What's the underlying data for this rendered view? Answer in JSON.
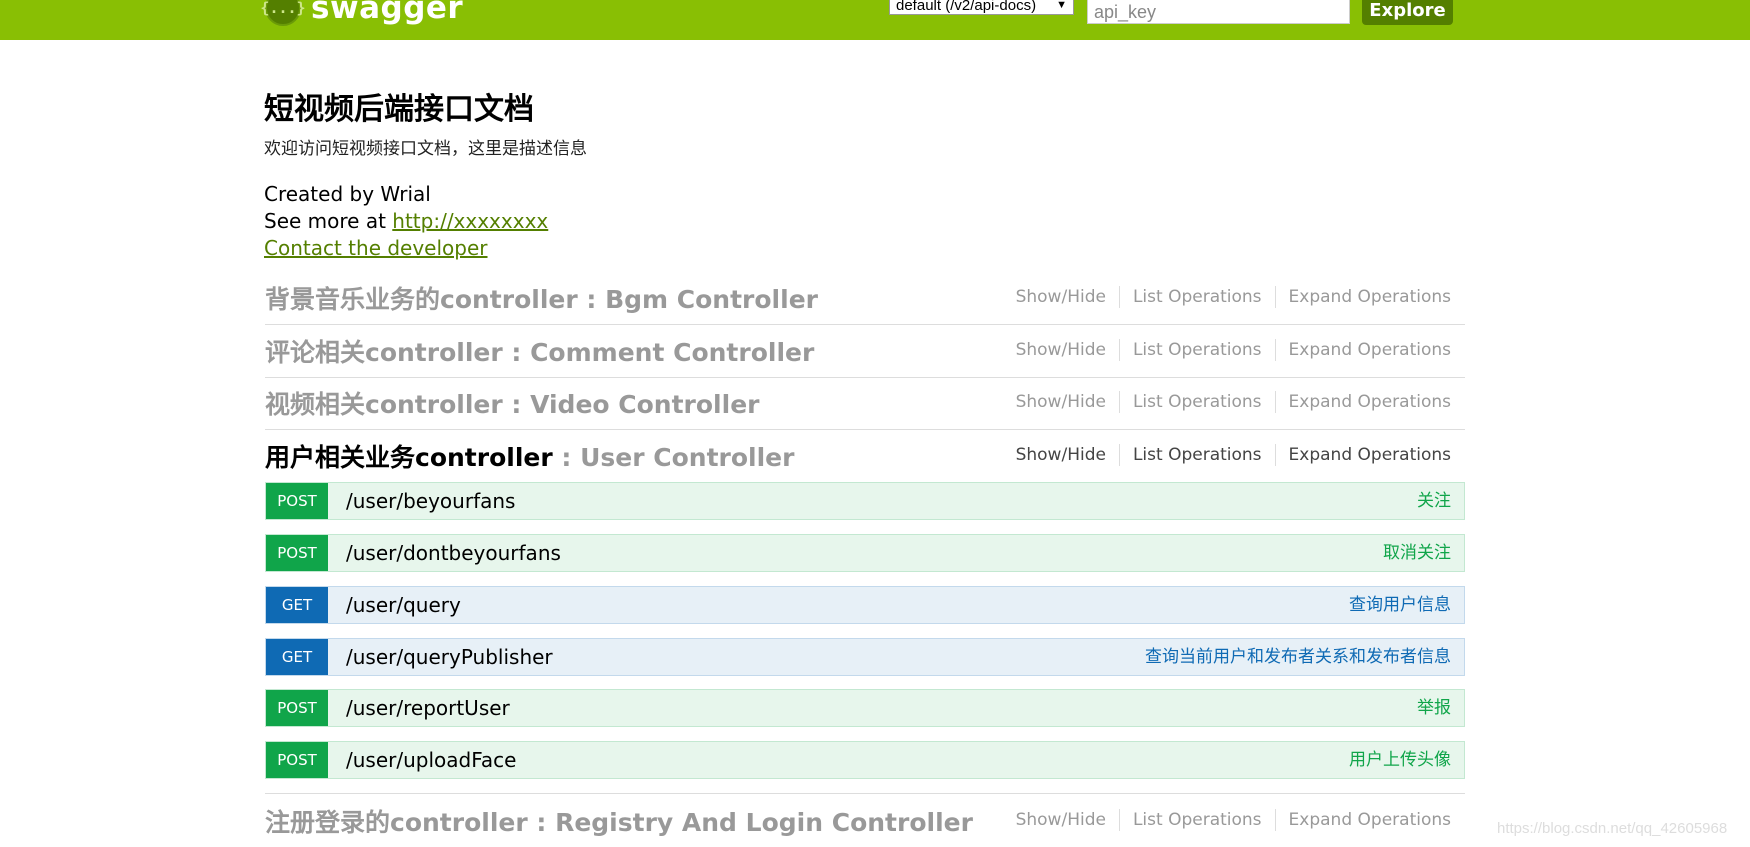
{
  "header": {
    "logo_glyph": "{...}",
    "logo_text": "swagger",
    "spec_select": "default (/v2/api-docs)",
    "api_key_placeholder": "api_key",
    "explore_label": "Explore",
    "background": "#89bf04"
  },
  "info": {
    "title": "短视频后端接口文档",
    "description": "欢迎访问短视频接口文档，这里是描述信息",
    "created_by": "Created by Wrial",
    "see_more_prefix": "See more at ",
    "see_more_link": "http://xxxxxxxx",
    "contact_link": "Contact the developer"
  },
  "resource_actions": {
    "show_hide": "Show/Hide",
    "list_operations": "List Operations",
    "expand_operations": "Expand Operations"
  },
  "resources": [
    {
      "prefix": "背景音乐业务的controller",
      "suffix": " : Bgm Controller"
    },
    {
      "prefix": "评论相关controller",
      "suffix": " : Comment Controller"
    },
    {
      "prefix": "视频相关controller",
      "suffix": " : Video Controller"
    },
    {
      "prefix": "用户相关业务controller",
      "suffix": " : User Controller"
    },
    {
      "prefix": "注册登录的controller",
      "suffix": " : Registry And Login Controller"
    }
  ],
  "operations": [
    {
      "method": "POST",
      "path": "/user/beyourfans",
      "summary": "关注"
    },
    {
      "method": "POST",
      "path": "/user/dontbeyourfans",
      "summary": "取消关注"
    },
    {
      "method": "GET",
      "path": "/user/query",
      "summary": "查询用户信息"
    },
    {
      "method": "GET",
      "path": "/user/queryPublisher",
      "summary": "查询当前用户和发布者关系和发布者信息"
    },
    {
      "method": "POST",
      "path": "/user/reportUser",
      "summary": "举报"
    },
    {
      "method": "POST",
      "path": "/user/uploadFace",
      "summary": "用户上传头像"
    }
  ],
  "colors": {
    "post": "#10a54a",
    "get": "#0f6ab4",
    "link": "#547f00"
  },
  "watermark": "https://blog.csdn.net/qq_42605968"
}
